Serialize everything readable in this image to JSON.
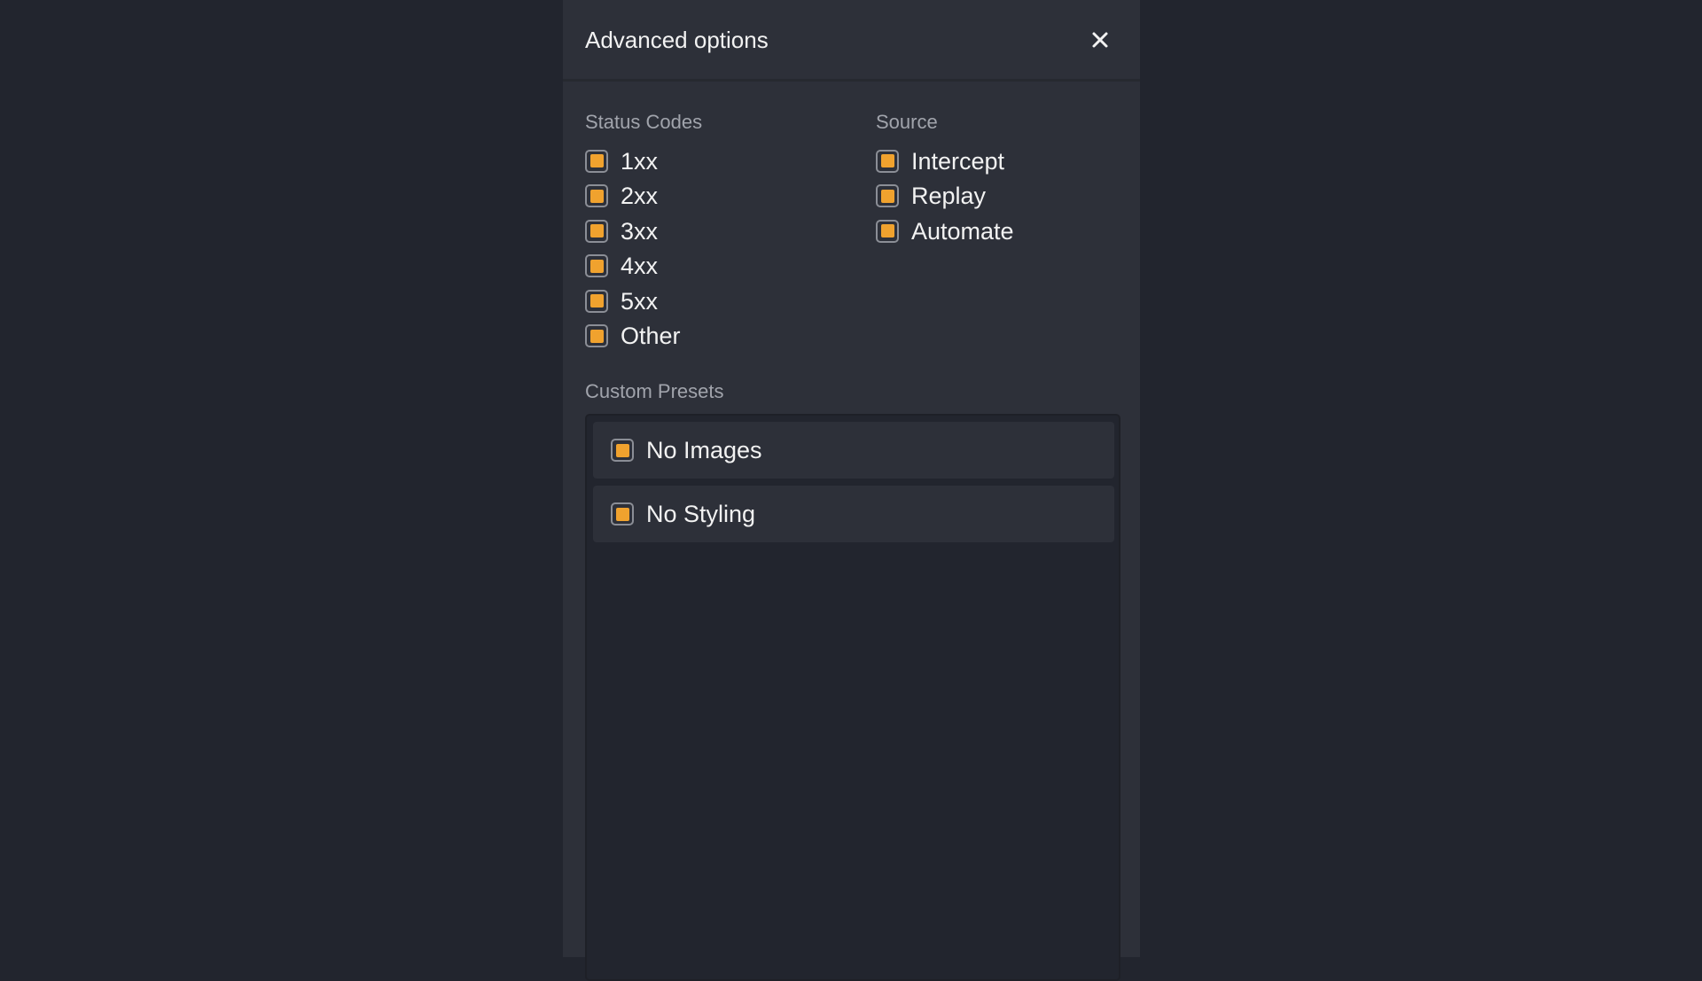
{
  "dialog": {
    "title": "Advanced options",
    "close_icon": "close-icon"
  },
  "status_codes": {
    "label": "Status Codes",
    "items": [
      {
        "label": "1xx",
        "checked": true
      },
      {
        "label": "2xx",
        "checked": true
      },
      {
        "label": "3xx",
        "checked": true
      },
      {
        "label": "4xx",
        "checked": true
      },
      {
        "label": "5xx",
        "checked": true
      },
      {
        "label": "Other",
        "checked": true
      }
    ]
  },
  "source": {
    "label": "Source",
    "items": [
      {
        "label": "Intercept",
        "checked": true
      },
      {
        "label": "Replay",
        "checked": true
      },
      {
        "label": "Automate",
        "checked": true
      }
    ]
  },
  "custom_presets": {
    "label": "Custom Presets",
    "items": [
      {
        "label": "No Images",
        "checked": true
      },
      {
        "label": "No Styling",
        "checked": true
      }
    ]
  },
  "colors": {
    "background": "#22252e",
    "panel": "#2d3039",
    "accent": "#f0a22e",
    "text": "#f2f2f2",
    "muted_text": "#a1a4ac"
  }
}
